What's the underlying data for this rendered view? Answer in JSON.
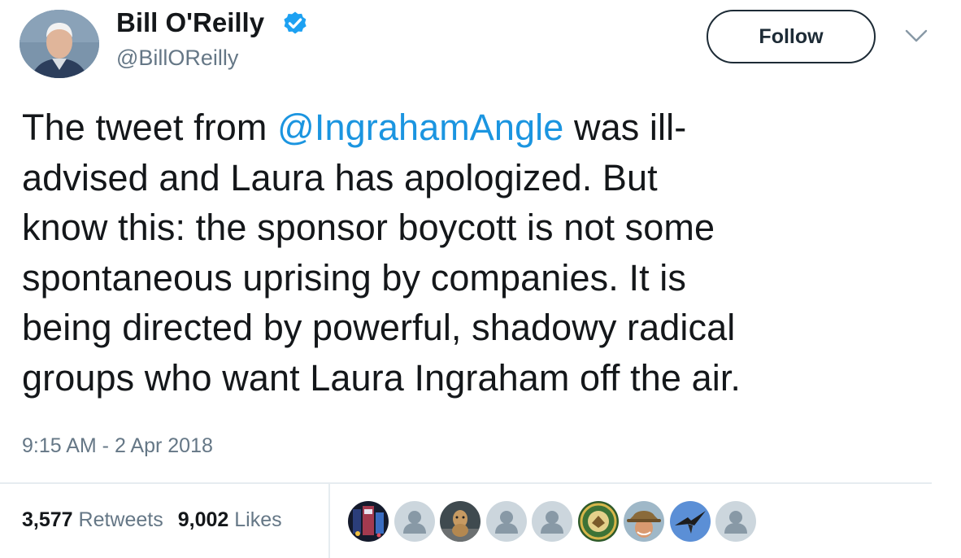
{
  "author": {
    "display_name": "Bill O'Reilly",
    "handle": "@BillOReilly",
    "verified": true
  },
  "follow_label": "Follow",
  "tweet": {
    "text_before": "The tweet from ",
    "mention": "@IngrahamAngle",
    "text_after": " was ill-\nadvised and Laura has apologized.  But\nknow this: the sponsor boycott is not some\nspontaneous uprising by companies.  It is\nbeing directed by powerful, shadowy radical\ngroups who want Laura Ingraham off the air."
  },
  "timestamp": "9:15 AM - 2 Apr 2018",
  "stats": {
    "retweets_count": "3,577",
    "retweets_label": "Retweets",
    "likes_count": "9,002",
    "likes_label": "Likes"
  },
  "colors": {
    "text": "#14171a",
    "secondary_text": "#657786",
    "link": "#1b95e0",
    "verified": "#1da1f2",
    "divider": "#e6ecf0"
  },
  "likers": [
    {
      "kind": "photo-dark-city"
    },
    {
      "kind": "default-avatar"
    },
    {
      "kind": "photo-animal"
    },
    {
      "kind": "default-avatar"
    },
    {
      "kind": "default-avatar"
    },
    {
      "kind": "photo-army-seal"
    },
    {
      "kind": "photo-person-hat"
    },
    {
      "kind": "photo-bird-sky"
    },
    {
      "kind": "default-avatar"
    }
  ]
}
